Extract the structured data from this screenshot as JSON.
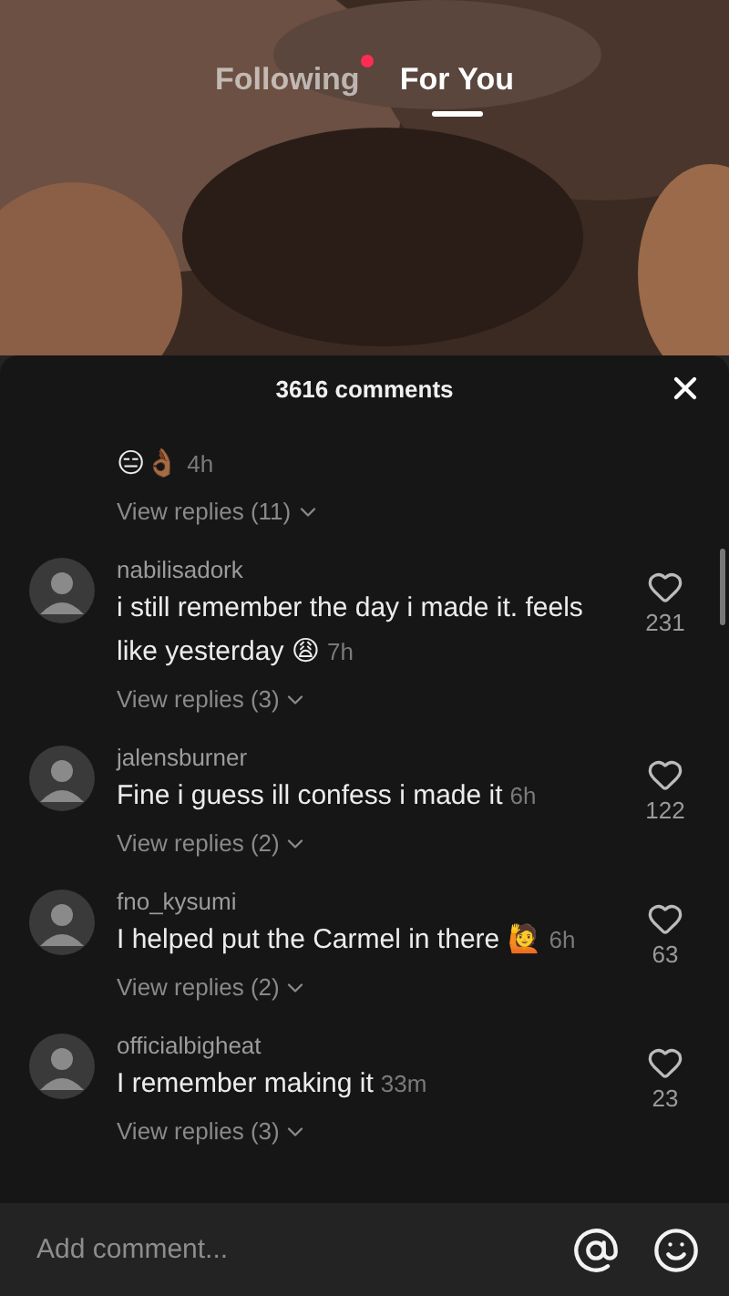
{
  "tabs": [
    {
      "label": "Following",
      "selected": false,
      "dot": true
    },
    {
      "label": "For You",
      "selected": true,
      "dot": false
    }
  ],
  "comments_panel": {
    "title": "3616 comments"
  },
  "comments": [
    {
      "text": "😑👌🏾",
      "time": "4h",
      "replies": "View replies (11)"
    },
    {
      "username": "nabilisadork",
      "text": "i still remember the day i made it. feels like yesterday 😩",
      "time": "7h",
      "likes": "231",
      "replies": "View replies (3)"
    },
    {
      "username": "jalensburner",
      "text": "Fine i guess ill confess i made it",
      "time": "6h",
      "likes": "122",
      "replies": "View replies (2)"
    },
    {
      "username": "fno_kysumi",
      "text": "I helped put the Carmel in there 🙋",
      "time": "6h",
      "likes": "63",
      "replies": "View replies (2)"
    },
    {
      "username": "officialbigheat",
      "text": "I remember making it",
      "time": "33m",
      "likes": "23",
      "replies": "View replies (3)"
    }
  ],
  "input": {
    "placeholder": "Add comment..."
  }
}
